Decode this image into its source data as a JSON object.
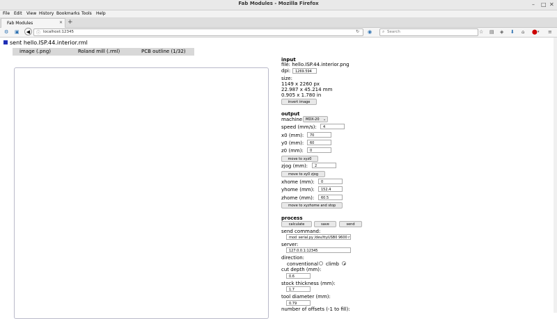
{
  "window": {
    "title": "Fab Modules - Mozilla Firefox"
  },
  "menu": [
    "File",
    "Edit",
    "View",
    "History",
    "Bookmarks",
    "Tools",
    "Help"
  ],
  "tab": {
    "label": "Fab Modules"
  },
  "nav": {
    "url": "localhost:12345",
    "search_placeholder": "Search"
  },
  "page": {
    "status": "sent hello.ISP.44.interior.rml",
    "formats": [
      "image (.png)",
      "Roland mill (.rml)",
      "PCB outline (1/32)"
    ],
    "input": {
      "heading": "input",
      "file_label": "file: hello.ISP.44.interior.png",
      "dpi_label": "dpi:",
      "dpi_value": "1269.594",
      "size_label": "size:",
      "size_px": "1149 x 2260 px",
      "size_mm": "22.987 x 45.214 mm",
      "size_in": "0.905 x 1.780 in",
      "invert_button": "invert image"
    },
    "output": {
      "heading": "output",
      "machine_label": "machine",
      "machine_value": "MDX-20",
      "speed_label": "speed (mm/s):",
      "speed_value": "4",
      "x0_label": "x0 (mm):",
      "x0_value": "70",
      "y0_label": "y0 (mm):",
      "y0_value": "60",
      "z0_label": "z0 (mm):",
      "z0_value": "0",
      "move_xyz0_button": "move to xyz0",
      "zjog_label": "zjog (mm):",
      "zjog_value": "2",
      "move_xy0_zjog_button": "move to xy0 zjog",
      "xhome_label": "xhome (mm):",
      "xhome_value": "0",
      "yhome_label": "yhome (mm):",
      "yhome_value": "152.4",
      "zhome_label": "zhome (mm):",
      "zhome_value": "60.5",
      "move_home_button": "move to xyzhome and stop"
    },
    "process": {
      "heading": "process",
      "calculate_button": "calculate",
      "save_button": "save",
      "send_button": "send",
      "send_command_label": "send command:",
      "send_command_value": "mod_serial.py /dev/ttyUSB0 9600 r",
      "server_label": "server:",
      "server_value": "127.0.0.1:12345",
      "direction_label": "direction:",
      "conventional_label": "conventional",
      "climb_label": "climb",
      "cut_depth_label": "cut depth (mm):",
      "cut_depth_value": "0.6",
      "stock_thickness_label": "stock thickness (mm):",
      "stock_thickness_value": "1.7",
      "tool_diameter_label": "tool diameter (mm):",
      "tool_diameter_value": "0.79",
      "offsets_label": "number of offsets (-1 to fill):"
    }
  }
}
